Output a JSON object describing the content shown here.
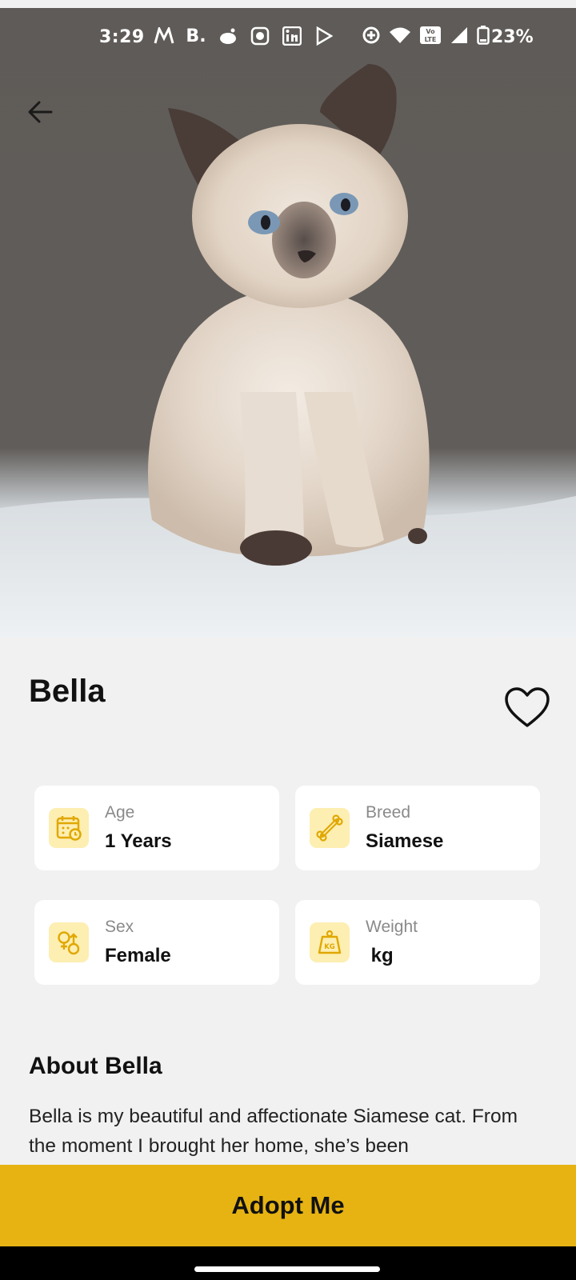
{
  "status_bar": {
    "time": "3:29",
    "battery": "23%",
    "notification_icons": [
      "myntra-icon",
      "bookmyshow-icon",
      "reddit-icon",
      "cricbuzz-icon",
      "linkedin-icon",
      "play-store-icon"
    ],
    "system_icons": [
      "data-saver-icon",
      "wifi-icon",
      "volte-icon",
      "signal-icon",
      "battery-icon"
    ],
    "volte_label": "Vo LTE"
  },
  "hero": {
    "image_subject": "siamese-kitten-photo",
    "back_icon": "arrow-left-icon"
  },
  "pet": {
    "name": "Bella",
    "favorite_icon": "heart-outline-icon"
  },
  "details": [
    {
      "label": "Age",
      "value": "1 Years",
      "icon": "calendar-icon"
    },
    {
      "label": "Breed",
      "value": "Siamese",
      "icon": "bone-icon"
    },
    {
      "label": "Sex",
      "value": "Female",
      "icon": "gender-icon"
    },
    {
      "label": "Weight",
      "value": " kg",
      "icon": "weight-kg-icon"
    }
  ],
  "weight_icon_text": "KG",
  "about": {
    "title": "About Bella",
    "text": "Bella is my beautiful and affectionate Siamese cat. From the moment I brought her home, she’s been"
  },
  "actions": {
    "adopt_label": "Adopt Me"
  },
  "colors": {
    "accent": "#e6b312",
    "icon_bg": "#fdeeb2",
    "icon_fg": "#e0a800",
    "page_bg": "#f1f1f1"
  }
}
